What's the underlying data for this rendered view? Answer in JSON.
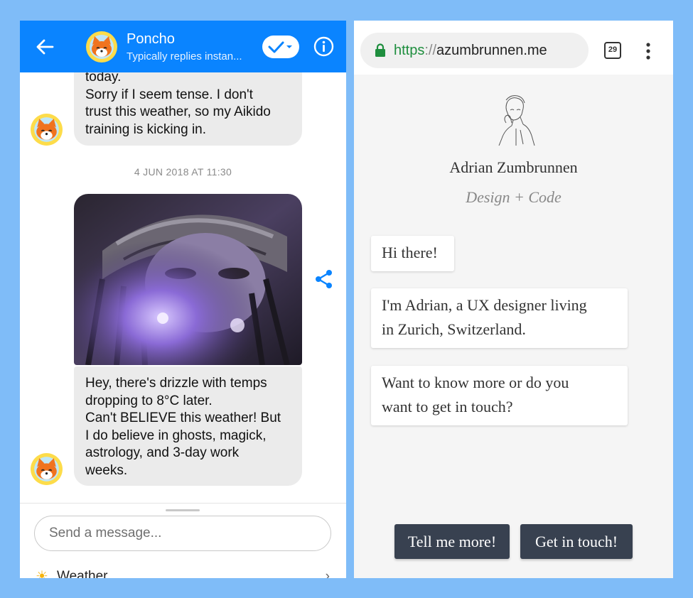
{
  "messenger": {
    "header": {
      "contact_name": "Poncho",
      "status": "Typically replies instan...",
      "accent": "#0a84ff"
    },
    "messages": {
      "first_bubble": [
        "today.",
        "Sorry if I seem tense. I don't",
        "trust this weather, so my Aikido",
        "training is kicking in."
      ],
      "timestamp": "4 JUN 2018 AT 11:30",
      "second_bubble": [
        "Hey, there's drizzle with temps",
        "dropping to 8°C later.",
        "Can't BELIEVE this weather! But",
        "I do believe in ghosts, magick,",
        "astrology, and 3-day work",
        "weeks."
      ]
    },
    "compose": {
      "placeholder": "Send a message..."
    },
    "quick_reply": {
      "label": "Weather"
    }
  },
  "browser": {
    "url": {
      "scheme": "https",
      "separator": "://",
      "host": "azumbrunnen.me"
    },
    "tab_count": "29",
    "page": {
      "name": "Adrian Zumbrunnen",
      "tagline": "Design + Code",
      "cards": [
        {
          "lines": [
            "Hi there!"
          ]
        },
        {
          "lines": [
            "I'm Adrian, a UX designer living",
            "in Zurich, Switzerland."
          ]
        },
        {
          "lines": [
            "Want to know more or do you",
            "want to get in touch?"
          ]
        }
      ],
      "buttons": {
        "more": "Tell me more!",
        "touch": "Get in touch!"
      }
    }
  }
}
